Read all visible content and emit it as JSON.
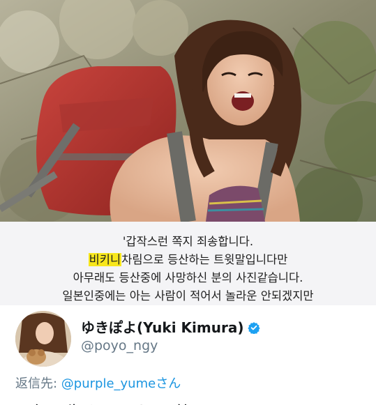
{
  "caption": {
    "line1": "'갑작스런 쪽지 죄송합니다.",
    "line2_highlight": "비키니",
    "line2_rest": "차림으로 등산하는 트윗말입니다만",
    "line3": "아무래도 등산중에 사망하신 분의 사진같습니다.",
    "line4": "일본인중에는 아는 사람이 적어서 놀라운 안되겠지만",
    "highlight_color": "#f8e71c"
  },
  "tweet": {
    "display_name": "ゆきぽよ(Yuki Kimura)",
    "handle": "@poyo_ngy",
    "reply_label": "返信先: ",
    "reply_to": "@purple_yume",
    "reply_suffix": "さん",
    "text": "元気に生きてます。 (笑)",
    "link_color": "#1b95e0",
    "verified_color": "#1da1f2"
  }
}
